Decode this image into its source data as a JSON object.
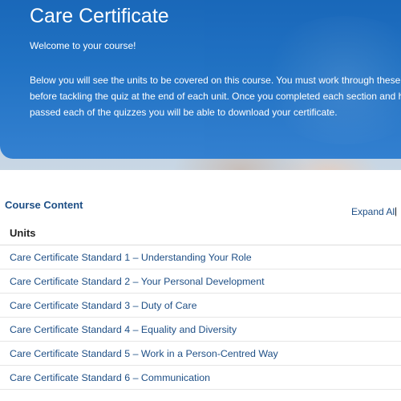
{
  "hero": {
    "title": "Care Certificate",
    "welcome": "Welcome to your course!",
    "intro_lines": [
      "Below you will see the units to be covered on this course. You must work through these in ord",
      "before tackling the quiz at the end of each unit. Once you completed each section and have",
      "passed each of the quizzes you will be able to download your certificate."
    ]
  },
  "course_content": {
    "title": "Course Content",
    "expand_all_label": "Expand All",
    "separator": "|",
    "units_header": "Units",
    "units": [
      "Care Certificate Standard 1 – Understanding Your Role",
      "Care Certificate Standard 2 – Your Personal Development",
      "Care Certificate Standard 3 – Duty of Care",
      "Care Certificate Standard 4 – Equality and Diversity",
      "Care Certificate Standard 5 – Work in a Person-Centred Way",
      "Care Certificate Standard 6 – Communication"
    ]
  },
  "colors": {
    "banner_blue": "#1c6fc2",
    "link_blue": "#1e4f86"
  }
}
